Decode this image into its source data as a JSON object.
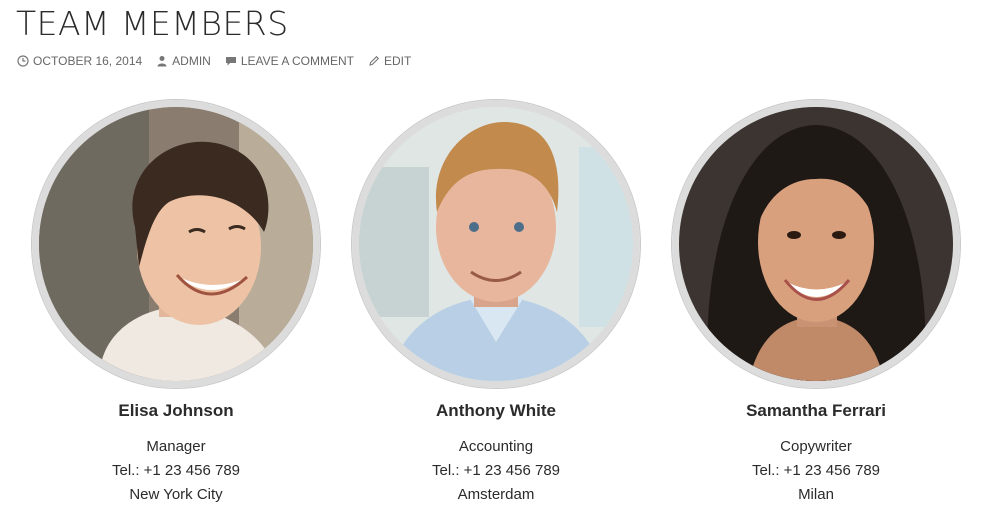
{
  "page": {
    "title": "TEAM MEMBERS"
  },
  "meta": {
    "date": "OCTOBER 16, 2014",
    "author": "ADMIN",
    "comment_link": "LEAVE A COMMENT",
    "edit_link": "EDIT"
  },
  "members": [
    {
      "name": "Elisa Johnson",
      "role": "Manager",
      "phone": "Tel.: +1 23 456 789",
      "city": "New York City"
    },
    {
      "name": "Anthony White",
      "role": "Accounting",
      "phone": "Tel.: +1 23 456 789",
      "city": "Amsterdam"
    },
    {
      "name": "Samantha Ferrari",
      "role": "Copywriter",
      "phone": "Tel.: +1 23 456 789",
      "city": "Milan"
    }
  ],
  "colors": {
    "text": "#2b2b2b",
    "meta": "#666666",
    "photo_ring": "#dcdcdc"
  },
  "icons": {
    "date": "clock-icon",
    "author": "user-icon",
    "comment": "comment-icon",
    "edit": "pencil-icon"
  }
}
